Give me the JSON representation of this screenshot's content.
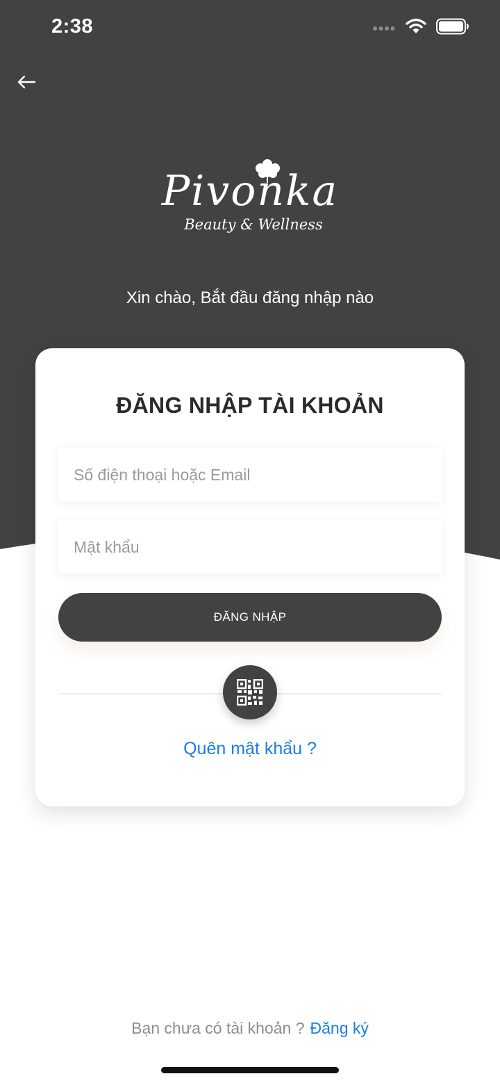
{
  "status_bar": {
    "time": "2:38",
    "icons": [
      "signal-dots-icon",
      "wifi-icon",
      "battery-icon"
    ]
  },
  "nav": {
    "back_icon": "arrow-left-icon"
  },
  "brand": {
    "name": "Pivonka",
    "tagline": "Beauty & Wellness"
  },
  "greeting": "Xin chào, Bắt đầu đăng nhập nào",
  "login_card": {
    "title": "ĐĂNG NHẬP TÀI KHOẢN",
    "phone_placeholder": "Số điện thoại hoặc Email",
    "password_placeholder": "Mật khẩu",
    "login_label": "ĐĂNG NHẬP",
    "qr_icon": "qr-code-icon",
    "forgot_label": "Quên mật khẩu ?"
  },
  "footer": {
    "question": "Bạn chưa có tài khoản ?",
    "signup_label": "Đăng ký"
  },
  "colors": {
    "header_bg": "#424242",
    "primary_button": "#424242",
    "link": "#1a7ee6",
    "placeholder": "#9a9a9a"
  }
}
